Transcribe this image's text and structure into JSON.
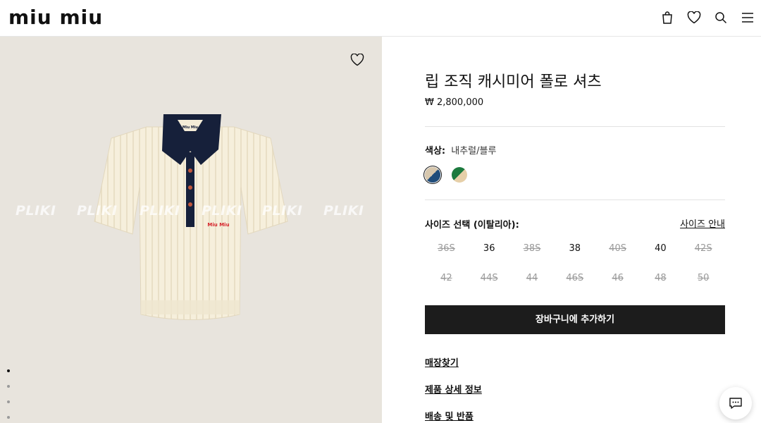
{
  "brand": {
    "logo_text": "miu miu"
  },
  "header": {
    "icons": [
      "bag-icon",
      "heart-icon",
      "search-icon",
      "menu-icon"
    ]
  },
  "gallery": {
    "watermark": "PLIKI",
    "collar_brand": "Miu Miu",
    "chest_brand": "Miu Miu",
    "slide_count": 4,
    "active_slide": 1
  },
  "product": {
    "title": "립 조직 캐시미어 폴로 셔츠",
    "price": "₩ 2,800,000",
    "color_label": "색상:",
    "color_value": "내추럴/블루",
    "swatches": [
      {
        "name": "natural-blue",
        "colors": [
          "#d7c7ad",
          "#1f4c7a"
        ],
        "selected": true
      },
      {
        "name": "green-natural",
        "colors": [
          "#1c7a3e",
          "#e6cfa8"
        ],
        "selected": false
      }
    ],
    "size_label": "사이즈 선택 (이탈리아):",
    "size_guide": "사이즈 안내",
    "sizes": [
      {
        "label": "36S",
        "available": false
      },
      {
        "label": "36",
        "available": true
      },
      {
        "label": "38S",
        "available": false
      },
      {
        "label": "38",
        "available": true
      },
      {
        "label": "40S",
        "available": false
      },
      {
        "label": "40",
        "available": true
      },
      {
        "label": "42S",
        "available": false
      },
      {
        "label": "42",
        "available": false
      },
      {
        "label": "44S",
        "available": false
      },
      {
        "label": "44",
        "available": false
      },
      {
        "label": "46S",
        "available": false
      },
      {
        "label": "46",
        "available": false
      },
      {
        "label": "48",
        "available": false
      },
      {
        "label": "50",
        "available": false
      }
    ],
    "add_to_cart": "장바구니에 추가하기",
    "links": {
      "store_finder": "매장찾기",
      "details": "제품 상세 정보",
      "shipping": "배송 및 반품"
    }
  },
  "chat": {
    "icon": "chat-icon"
  }
}
